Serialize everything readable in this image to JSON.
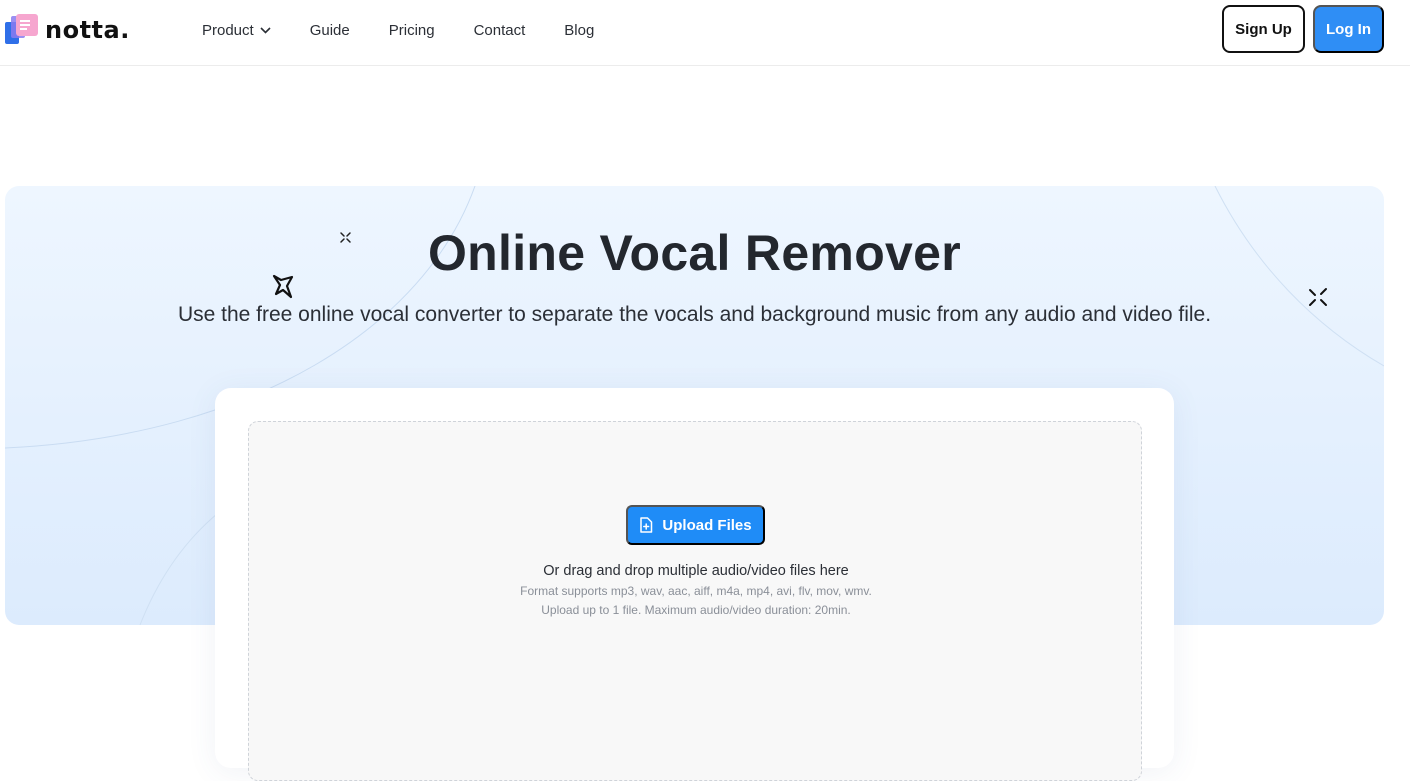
{
  "brand": {
    "name": "notta.",
    "colors": {
      "primary": "#2f8ef5",
      "upload": "#1f8cf7",
      "text": "#23272e"
    }
  },
  "nav": {
    "items": [
      {
        "label": "Product",
        "has_dropdown": true
      },
      {
        "label": "Guide"
      },
      {
        "label": "Pricing"
      },
      {
        "label": "Contact"
      },
      {
        "label": "Blog"
      }
    ]
  },
  "auth": {
    "signup_label": "Sign Up",
    "login_label": "Log In"
  },
  "hero": {
    "title": "Online Vocal Remover",
    "subtitle": "Use the free online vocal converter to separate the vocals and background music from any audio and video file."
  },
  "upload": {
    "button_label": "Upload Files",
    "icon": "file-upload-icon",
    "drag_text": "Or drag and drop multiple audio/video files here",
    "formats_text": "Format supports mp3, wav, aac, aiff, m4a, mp4, avi, flv, mov, wmv.",
    "limit_text": "Upload up to 1 file. Maximum audio/video duration: 20min."
  }
}
